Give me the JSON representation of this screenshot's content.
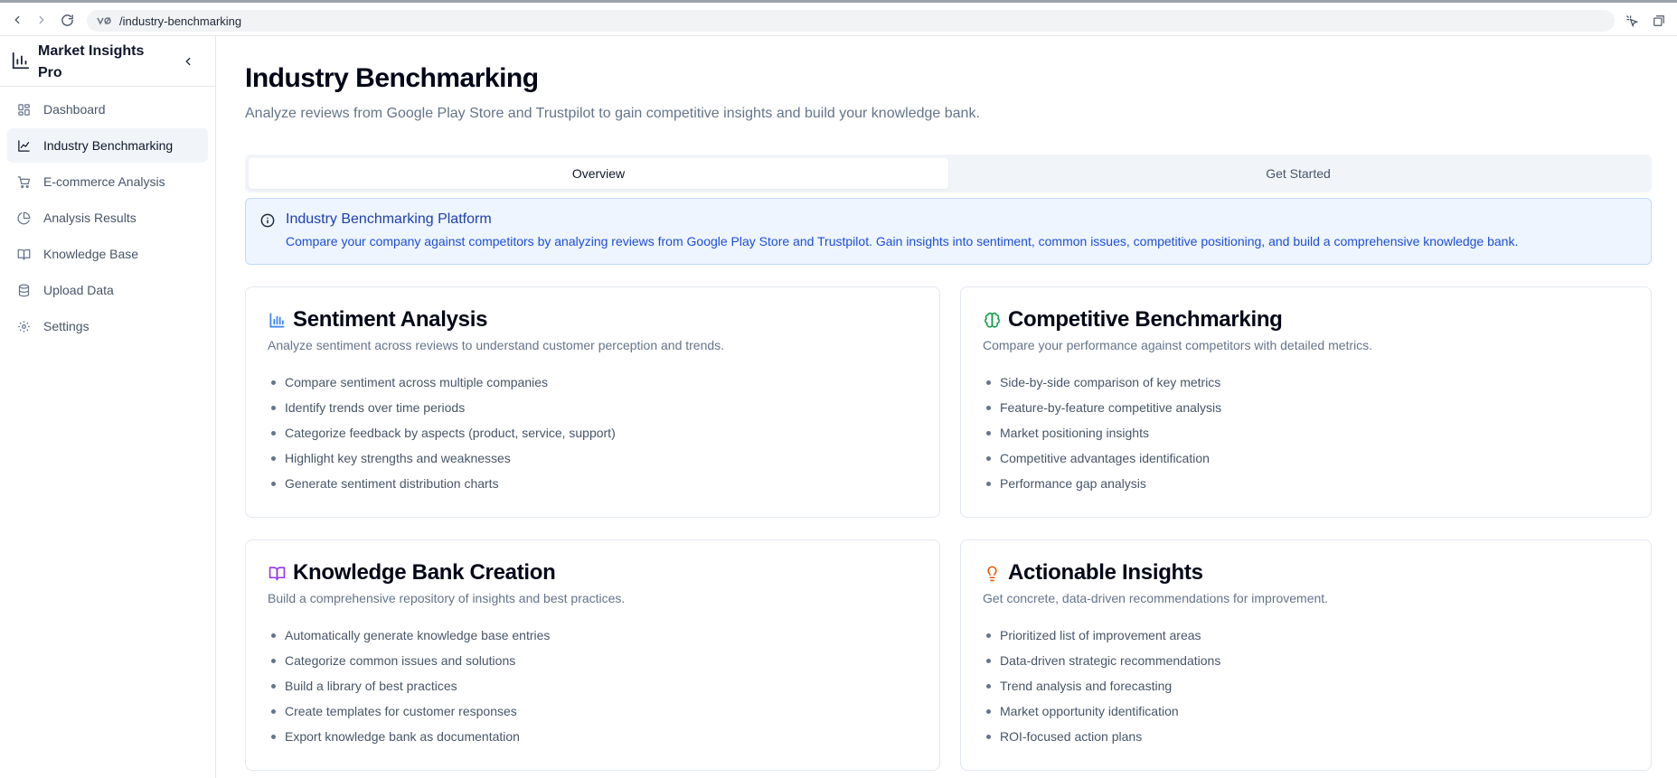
{
  "browser": {
    "url": "/industry-benchmarking"
  },
  "sidebar": {
    "app_title": "Market Insights Pro",
    "items": [
      {
        "label": "Dashboard",
        "icon": "dashboard-icon"
      },
      {
        "label": "Industry Benchmarking",
        "icon": "line-chart-icon",
        "active": true
      },
      {
        "label": "E-commerce Analysis",
        "icon": "shopping-cart-icon"
      },
      {
        "label": "Analysis Results",
        "icon": "pie-chart-icon"
      },
      {
        "label": "Knowledge Base",
        "icon": "book-open-icon"
      },
      {
        "label": "Upload Data",
        "icon": "database-icon"
      },
      {
        "label": "Settings",
        "icon": "gear-icon"
      }
    ]
  },
  "main": {
    "title": "Industry Benchmarking",
    "subtitle": "Analyze reviews from Google Play Store and Trustpilot to gain competitive insights and build your knowledge bank.",
    "tabs": [
      {
        "label": "Overview",
        "active": true
      },
      {
        "label": "Get Started",
        "active": false
      }
    ],
    "info": {
      "title": "Industry Benchmarking Platform",
      "description": "Compare your company against competitors by analyzing reviews from Google Play Store and Trustpilot. Gain insights into sentiment, common issues, competitive positioning, and build a comprehensive knowledge bank."
    },
    "cards": [
      {
        "title": "Sentiment Analysis",
        "icon": "bar-chart-icon",
        "icon_color": "#3b82f6",
        "description": "Analyze sentiment across reviews to understand customer perception and trends.",
        "items": [
          "Compare sentiment across multiple companies",
          "Identify trends over time periods",
          "Categorize feedback by aspects (product, service, support)",
          "Highlight key strengths and weaknesses",
          "Generate sentiment distribution charts"
        ]
      },
      {
        "title": "Competitive Benchmarking",
        "icon": "brain-icon",
        "icon_color": "#16a34a",
        "description": "Compare your performance against competitors with detailed metrics.",
        "items": [
          "Side-by-side comparison of key metrics",
          "Feature-by-feature competitive analysis",
          "Market positioning insights",
          "Competitive advantages identification",
          "Performance gap analysis"
        ]
      },
      {
        "title": "Knowledge Bank Creation",
        "icon": "book-open-icon",
        "icon_color": "#9333ea",
        "description": "Build a comprehensive repository of insights and best practices.",
        "items": [
          "Automatically generate knowledge base entries",
          "Categorize common issues and solutions",
          "Build a library of best practices",
          "Create templates for customer responses",
          "Export knowledge bank as documentation"
        ]
      },
      {
        "title": "Actionable Insights",
        "icon": "lightbulb-icon",
        "icon_color": "#ea580c",
        "description": "Get concrete, data-driven recommendations for improvement.",
        "items": [
          "Prioritized list of improvement areas",
          "Data-driven strategic recommendations",
          "Trend analysis and forecasting",
          "Market opportunity identification",
          "ROI-focused action plans"
        ]
      }
    ]
  }
}
